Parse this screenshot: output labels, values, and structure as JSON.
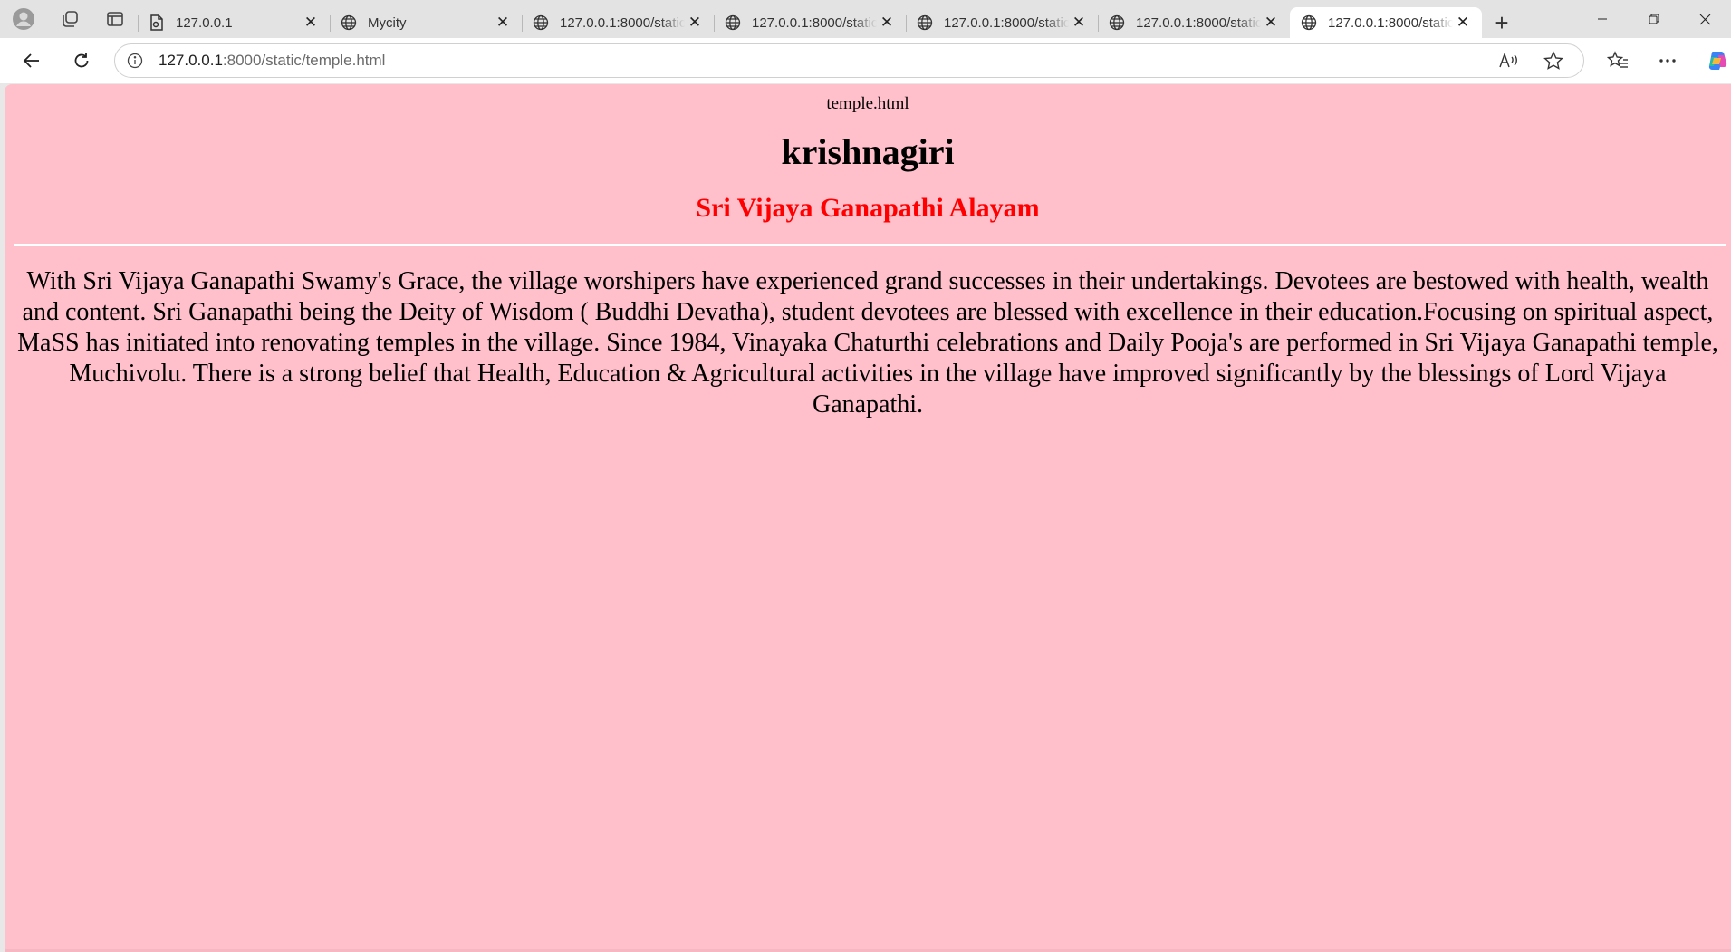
{
  "browser": {
    "tabs": [
      {
        "title": "127.0.0.1",
        "icon": "document-icon",
        "active": false
      },
      {
        "title": "Mycity",
        "icon": "globe-icon",
        "active": false
      },
      {
        "title": "127.0.0.1:8000/static",
        "icon": "globe-icon",
        "active": false
      },
      {
        "title": "127.0.0.1:8000/static",
        "icon": "globe-icon",
        "active": false
      },
      {
        "title": "127.0.0.1:8000/static",
        "icon": "globe-icon",
        "active": false
      },
      {
        "title": "127.0.0.1:8000/static",
        "icon": "globe-icon",
        "active": false
      },
      {
        "title": "127.0.0.1:8000/static",
        "icon": "globe-icon",
        "active": true
      }
    ],
    "address": {
      "host": "127.0.0.1",
      "rest": ":8000/static/temple.html"
    }
  },
  "page": {
    "doc_title": "temple.html",
    "heading": "krishnagiri",
    "subheading": "Sri Vijaya Ganapathi Alayam",
    "paragraph": "With Sri Vijaya Ganapathi Swamy's Grace, the village worshipers have experienced grand successes in their undertakings. Devotees are bestowed with health, wealth and content. Sri Ganapathi being the Deity of Wisdom ( Buddhi Devatha), student devotees are blessed with excellence in their education.Focusing on spiritual aspect, MaSS has initiated into renovating temples in the village. Since 1984, Vinayaka Chaturthi celebrations and Daily Pooja's are performed in Sri Vijaya Ganapathi temple, Muchivolu. There is a strong belief that Health, Education & Agricultural activities in the village have improved significantly by the blessings of Lord Vijaya Ganapathi.",
    "colors": {
      "background": "#ffc0cb",
      "subheading": "#ff0000",
      "divider": "#ffffff"
    }
  }
}
